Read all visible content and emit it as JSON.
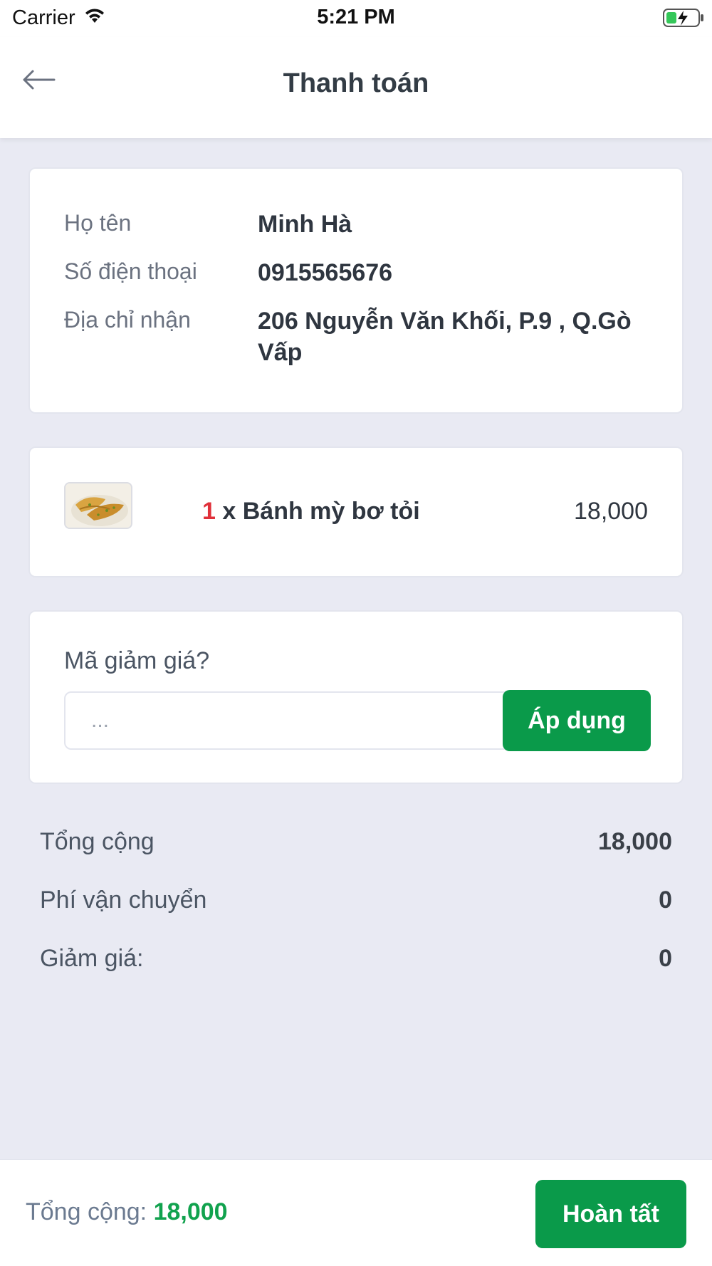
{
  "status_bar": {
    "carrier": "Carrier",
    "time": "5:21 PM",
    "icons": [
      "wifi-icon",
      "battery-charging-icon"
    ]
  },
  "header": {
    "title": "Thanh toán",
    "back_icon": "arrow-left-icon"
  },
  "customer": {
    "name_label": "Họ tên",
    "name_value": "Minh Hà",
    "phone_label": "Số điện thoại",
    "phone_value": "0915565676",
    "address_label": "Địa chỉ nhận",
    "address_value": "206 Nguyễn Văn Khối, P.9 , Q.Gò Vấp"
  },
  "order_items": [
    {
      "quantity": "1",
      "name": "x Bánh mỳ bơ tỏi",
      "price": "18,000",
      "thumbnail": "garlic-bread-image"
    }
  ],
  "coupon": {
    "label": "Mã giảm giá?",
    "placeholder": "...",
    "value": "",
    "apply_label": "Áp dụng"
  },
  "summary": {
    "subtotal_label": "Tổng cộng",
    "subtotal_value": "18,000",
    "shipping_label": "Phí vận chuyển",
    "shipping_value": "0",
    "discount_label": "Giảm giá:",
    "discount_value": "0"
  },
  "footer": {
    "total_label": "Tổng cộng:",
    "total_value": "18,000",
    "finish_label": "Hoàn tất"
  },
  "colors": {
    "accent_green": "#0a9a4a",
    "quantity_red": "#e0303a",
    "background": "#e9eaf3"
  }
}
